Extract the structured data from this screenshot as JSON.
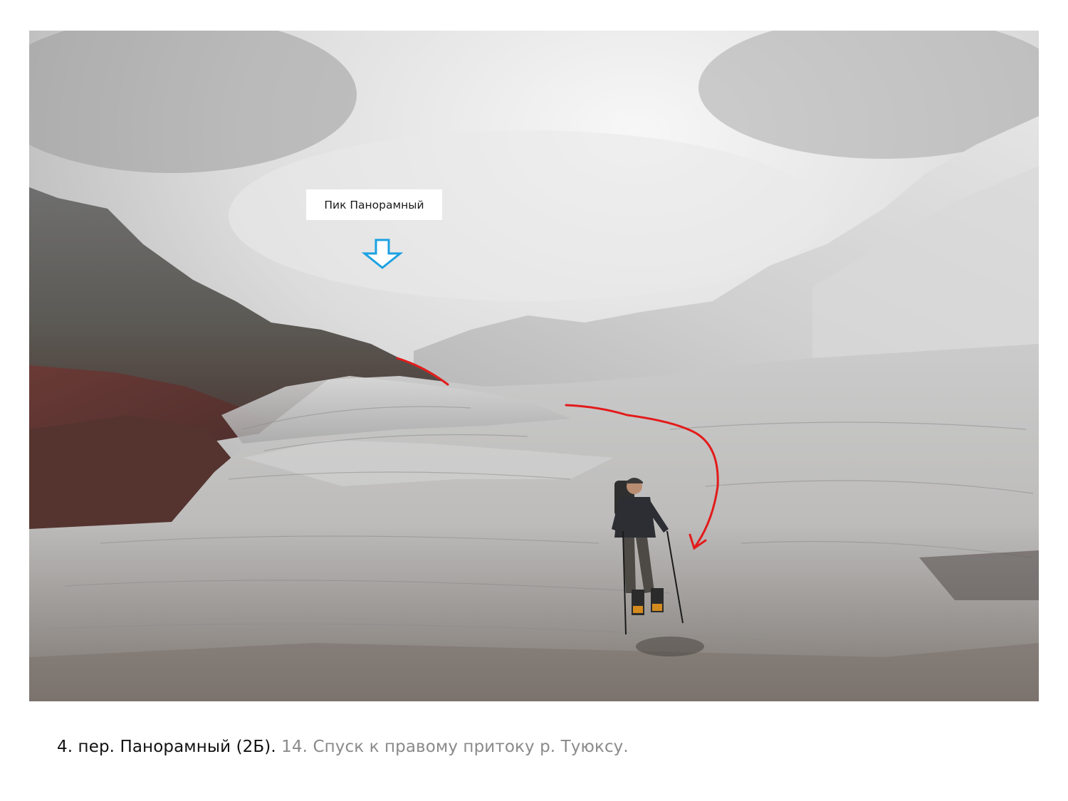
{
  "photo": {
    "annotation_label": "Пик Панорамный",
    "arrow_color": "#1ba1e2",
    "route_color": "#e31b1b"
  },
  "caption": {
    "main": "4. пер. Панорамный (2Б).",
    "sub": "14. Спуск к правому притоку р. Туюксу."
  }
}
